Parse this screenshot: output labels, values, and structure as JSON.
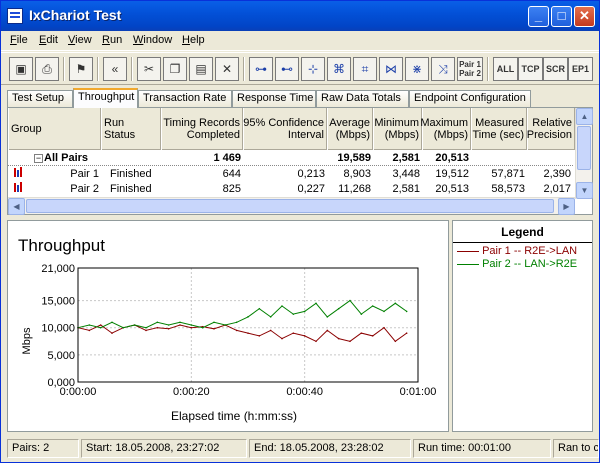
{
  "window": {
    "title": "IxChariot Test"
  },
  "menu": [
    "File",
    "Edit",
    "View",
    "Run",
    "Window",
    "Help"
  ],
  "toolbar": {
    "pair_label": "Pair 1\nPair 2",
    "all": "ALL",
    "tcp": "TCP",
    "scr": "SCR",
    "ep1": "EP1"
  },
  "tabs": [
    "Test Setup",
    "Throughput",
    "Transaction Rate",
    "Response Time",
    "Raw Data Totals",
    "Endpoint Configuration"
  ],
  "active_tab": "Throughput",
  "grid": {
    "headers": {
      "group": "Group",
      "run_status": "Run Status",
      "timing_records": "Timing Records\nCompleted",
      "confidence": "95% Confidence\nInterval",
      "average": "Average\n(Mbps)",
      "minimum": "Minimum\n(Mbps)",
      "maximum": "Maximum\n(Mbps)",
      "measured_time": "Measured\nTime (sec)",
      "relative_precision": "Relative\nPrecision"
    },
    "all_pairs": {
      "label": "All Pairs",
      "records": "1 469",
      "average": "19,589",
      "minimum": "2,581",
      "maximum": "20,513"
    },
    "rows": [
      {
        "pair": "Pair 1",
        "status": "Finished",
        "records": "644",
        "ci": "0,213",
        "avg": "8,903",
        "min": "3,448",
        "max": "19,512",
        "time": "57,871",
        "prec": "2,390"
      },
      {
        "pair": "Pair 2",
        "status": "Finished",
        "records": "825",
        "ci": "0,227",
        "avg": "11,268",
        "min": "2,581",
        "max": "20,513",
        "time": "58,573",
        "prec": "2,017"
      }
    ]
  },
  "chart_data": {
    "type": "line",
    "title": "Throughput",
    "xlabel": "Elapsed time (h:mm:ss)",
    "ylabel": "Mbps",
    "xlim": [
      0,
      60
    ],
    "ylim": [
      0,
      21000
    ],
    "x_ticks": [
      "0:00:00",
      "0:00:20",
      "0:00:40",
      "0:01:00"
    ],
    "y_ticks": [
      "0,000",
      "5,000",
      "10,000",
      "15,000",
      "21,000"
    ],
    "y_tick_values": [
      0,
      5000,
      10000,
      15000,
      21000
    ],
    "grid": true,
    "series": [
      {
        "name": "Pair 1 -- R2E->LAN",
        "color": "#8b0000",
        "x": [
          0,
          2,
          4,
          6,
          8,
          10,
          12,
          14,
          16,
          18,
          20,
          22,
          24,
          26,
          28,
          30,
          32,
          34,
          36,
          38,
          40,
          42,
          44,
          46,
          48,
          50,
          52,
          54,
          56,
          58
        ],
        "values": [
          10000,
          9500,
          10500,
          9000,
          10000,
          10500,
          9500,
          10000,
          9800,
          10500,
          10000,
          10200,
          9800,
          10500,
          9500,
          9000,
          8500,
          9500,
          8000,
          9000,
          8500,
          7500,
          9500,
          8000,
          7500,
          9000,
          8500,
          10000,
          7500,
          9000
        ]
      },
      {
        "name": "Pair 2 -- LAN->R2E",
        "color": "#008000",
        "x": [
          0,
          2,
          4,
          6,
          8,
          10,
          12,
          14,
          16,
          18,
          20,
          22,
          24,
          26,
          28,
          30,
          32,
          34,
          36,
          38,
          40,
          42,
          44,
          46,
          48,
          50,
          52,
          54,
          56,
          58
        ],
        "values": [
          10000,
          10500,
          10000,
          11000,
          10000,
          10500,
          10000,
          11000,
          10500,
          11000,
          10500,
          10000,
          11000,
          10500,
          11000,
          12000,
          13500,
          12000,
          14000,
          12500,
          13000,
          14500,
          12000,
          13500,
          15000,
          12500,
          14000,
          13000,
          14500,
          13000
        ]
      }
    ],
    "legend_title": "Legend",
    "legend_position": "right"
  },
  "status": {
    "pairs": "Pairs: 2",
    "start": "Start: 18.05.2008, 23:27:02",
    "end": "End: 18.05.2008, 23:28:02",
    "run_time": "Run time: 00:01:00",
    "ran_to": "Ran to c"
  }
}
